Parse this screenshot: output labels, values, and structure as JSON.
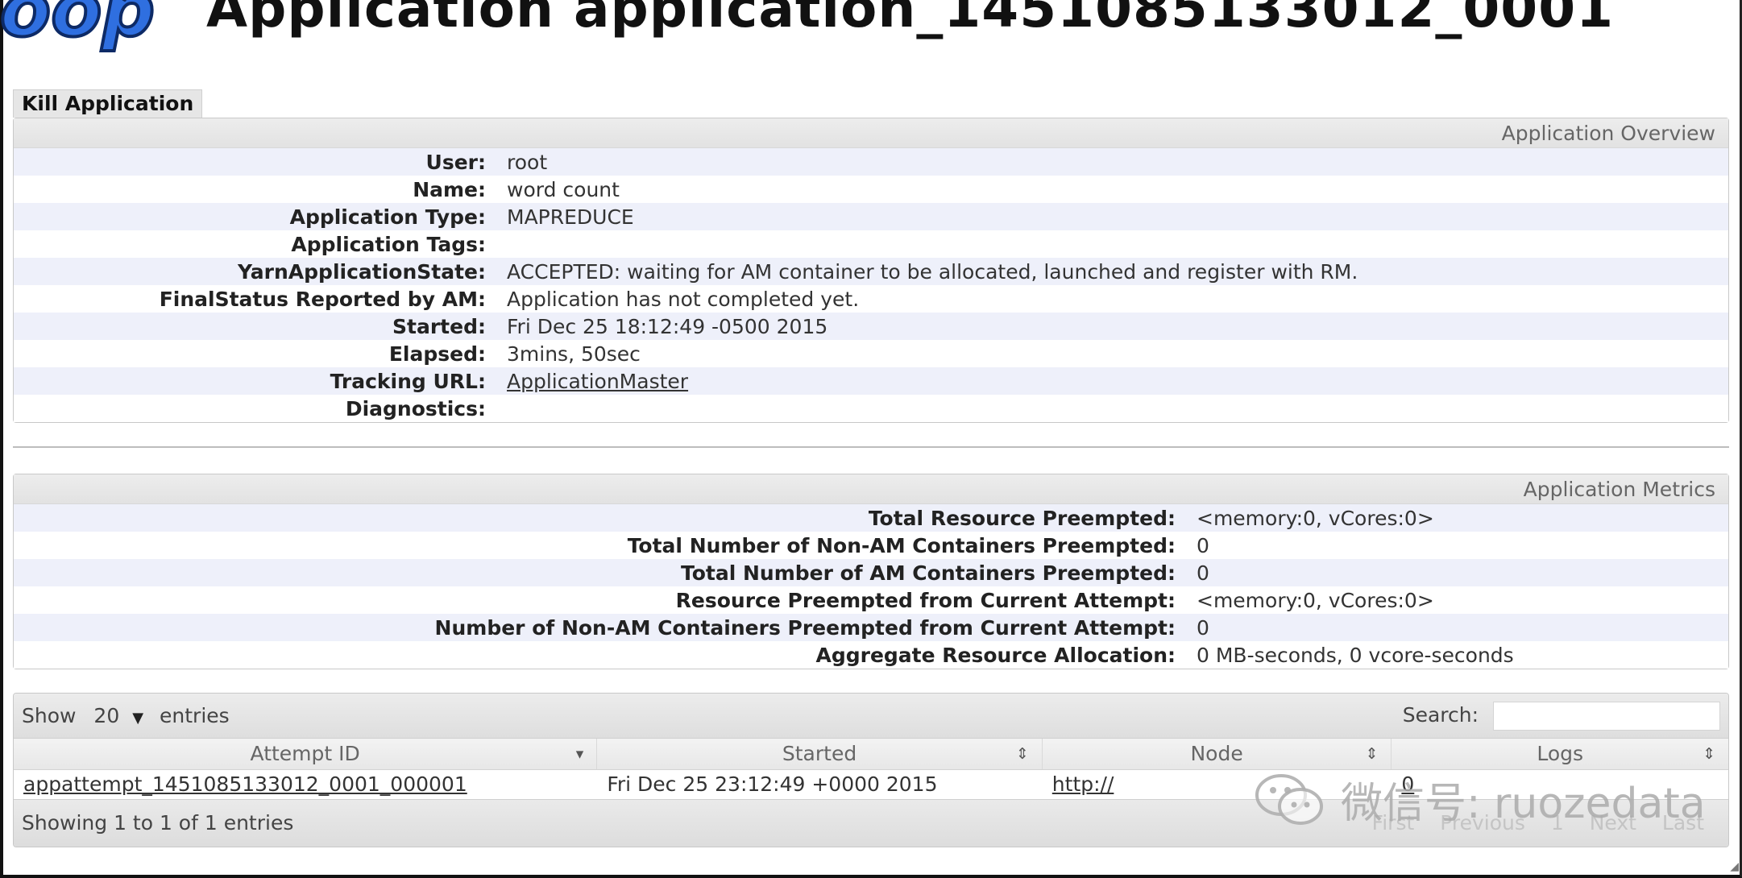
{
  "header": {
    "logo_text": "oop",
    "title": "Application application_1451085133012_0001"
  },
  "actions": {
    "kill_label": "Kill Application"
  },
  "overview": {
    "title": "Application Overview",
    "rows": [
      {
        "label": "User:",
        "value": "root"
      },
      {
        "label": "Name:",
        "value": "word count"
      },
      {
        "label": "Application Type:",
        "value": "MAPREDUCE"
      },
      {
        "label": "Application Tags:",
        "value": ""
      },
      {
        "label": "YarnApplicationState:",
        "value": "ACCEPTED: waiting for AM container to be allocated, launched and register with RM."
      },
      {
        "label": "FinalStatus Reported by AM:",
        "value": "Application has not completed yet."
      },
      {
        "label": "Started:",
        "value": "Fri Dec 25 18:12:49 -0500 2015"
      },
      {
        "label": "Elapsed:",
        "value": "3mins, 50sec"
      },
      {
        "label": "Tracking URL:",
        "value": "ApplicationMaster"
      },
      {
        "label": "Diagnostics:",
        "value": ""
      }
    ]
  },
  "metrics": {
    "title": "Application Metrics",
    "rows": [
      {
        "label": "Total Resource Preempted:",
        "value": "<memory:0, vCores:0>"
      },
      {
        "label": "Total Number of Non-AM Containers Preempted:",
        "value": "0"
      },
      {
        "label": "Total Number of AM Containers Preempted:",
        "value": "0"
      },
      {
        "label": "Resource Preempted from Current Attempt:",
        "value": "<memory:0, vCores:0>"
      },
      {
        "label": "Number of Non-AM Containers Preempted from Current Attempt:",
        "value": "0"
      },
      {
        "label": "Aggregate Resource Allocation:",
        "value": "0 MB-seconds, 0 vcore-seconds"
      }
    ]
  },
  "attempts": {
    "show_label": "Show",
    "page_size": "20",
    "entries_label": "entries",
    "search_label": "Search:",
    "search_value": "",
    "columns": [
      "Attempt ID",
      "Started",
      "Node",
      "Logs"
    ],
    "rows": [
      {
        "attempt_id": "appattempt_1451085133012_0001_000001",
        "started": "Fri Dec 25 23:12:49 +0000 2015",
        "node": "http://",
        "logs": "0"
      }
    ],
    "info": "Showing 1 to 1 of 1 entries",
    "pagination": {
      "first": "First",
      "previous": "Previous",
      "page": "1",
      "next": "Next",
      "last": "Last"
    }
  },
  "watermark": {
    "text": "微信号: ruozedata"
  },
  "colors": {
    "row_stripe": "#eef0fa",
    "logo_blue": "#2f6fe0",
    "title_text": "#111111"
  }
}
